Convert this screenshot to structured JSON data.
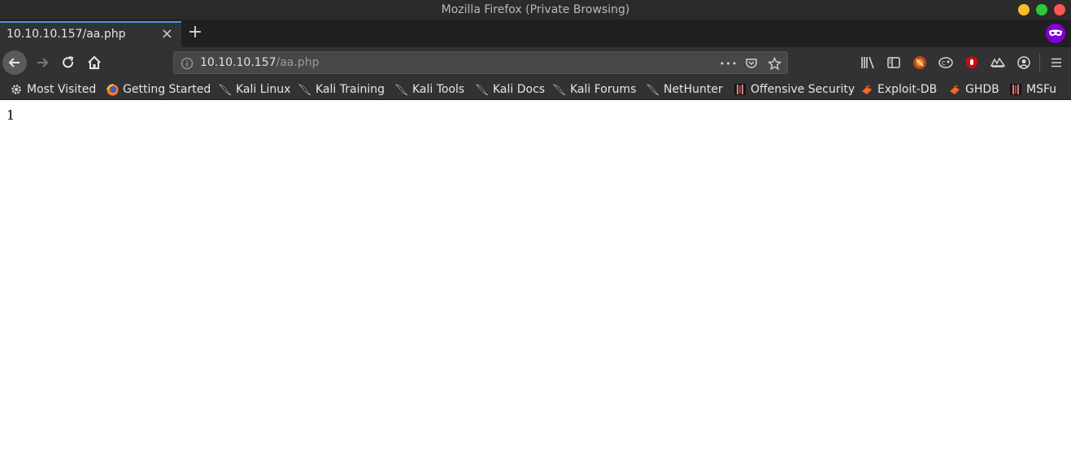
{
  "window": {
    "title": "Mozilla Firefox (Private Browsing)"
  },
  "tabs": [
    {
      "title": "10.10.10.157/aa.php",
      "close": "×"
    }
  ],
  "newtab": "+",
  "address": {
    "host": "10.10.10.157",
    "path": "/aa.php",
    "actions": "•••"
  },
  "bookmarks": [
    {
      "label": "Most Visited",
      "icon": "gear-icon"
    },
    {
      "label": "Getting Started",
      "icon": "firefox-icon"
    },
    {
      "label": "Kali Linux",
      "icon": "kali-dragon-icon"
    },
    {
      "label": "Kali Training",
      "icon": "kali-dragon-icon"
    },
    {
      "label": "Kali Tools",
      "icon": "kali-dragon-icon"
    },
    {
      "label": "Kali Docs",
      "icon": "kali-dragon-icon"
    },
    {
      "label": "Kali Forums",
      "icon": "kali-dragon-icon"
    },
    {
      "label": "NetHunter",
      "icon": "kali-dragon-icon"
    },
    {
      "label": "Offensive Security",
      "icon": "offsec-icon"
    },
    {
      "label": "Exploit-DB",
      "icon": "exploit-db-icon"
    },
    {
      "label": "GHDB",
      "icon": "exploit-db-icon"
    },
    {
      "label": "MSFu",
      "icon": "offsec-icon"
    }
  ],
  "page": {
    "body_text": "1"
  },
  "colors": {
    "chrome_dark": "#323234",
    "tab_accent": "#4a90e2",
    "private_purple": "#8000d7"
  }
}
